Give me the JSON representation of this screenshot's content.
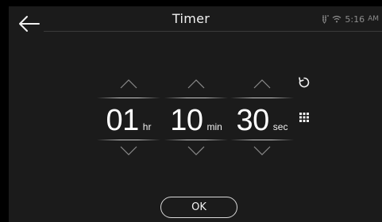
{
  "header": {
    "title": "Timer",
    "time": "5:16",
    "ampm": "AM"
  },
  "timer": {
    "hours": {
      "value": "01",
      "unit": "hr"
    },
    "minutes": {
      "value": "10",
      "unit": "min"
    },
    "seconds": {
      "value": "30",
      "unit": "sec"
    }
  },
  "actions": {
    "ok_label": "OK"
  },
  "icons": {
    "back": "back-arrow-icon",
    "sensor": "sensor-icon",
    "wifi": "wifi-icon",
    "reset": "reset-icon",
    "keypad": "keypad-icon",
    "chevron_up": "chevron-up-icon",
    "chevron_down": "chevron-down-icon"
  }
}
